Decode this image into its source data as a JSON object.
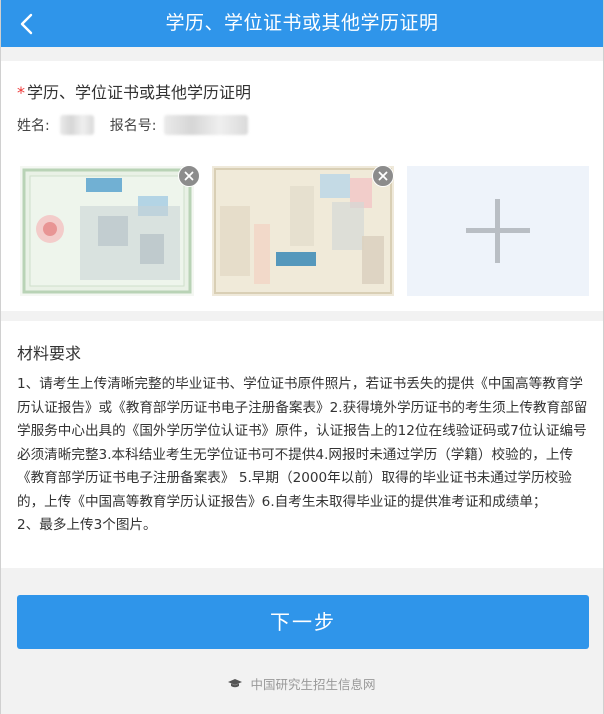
{
  "header": {
    "back_icon": "chevron-left-icon",
    "title": "学历、学位证书或其他学历证明"
  },
  "upload": {
    "required_mark": "*",
    "section_title": "学历、学位证书或其他学历证明",
    "name_label": "姓名:",
    "reg_no_label": "报名号:",
    "uploaded_count": 2,
    "add_icon": "plus-icon",
    "remove_icon": "close-circle-icon"
  },
  "requirements": {
    "title": "材料要求",
    "item1": "1、请考生上传清晰完整的毕业证书、学位证书原件照片，若证书丢失的提供《中国高等教育学历认证报告》或《教育部学历证书电子注册备案表》2.获得境外学历证书的考生须上传教育部留学服务中心出具的《国外学历学位认证书》原件，认证报告上的12位在线验证码或7位认证编号必须清晰完整3.本科结业考生无学位证书可不提供4.网报时未通过学历（学籍）校验的，上传《教育部学历证书电子注册备案表》 5.早期（2000年以前）取得的毕业证书未通过学历校验的，上传《中国高等教育学历认证报告》6.自考生未取得毕业证的提供准考证和成绩单；",
    "item2": "2、最多上传3个图片。"
  },
  "actions": {
    "next_label": "下一步"
  },
  "footer": {
    "logo_icon": "graduation-cap-icon",
    "text": "中国研究生招生信息网"
  },
  "colors": {
    "primary": "#2f95ea",
    "required": "#e33333",
    "add_tile_bg": "#eef3fa"
  }
}
